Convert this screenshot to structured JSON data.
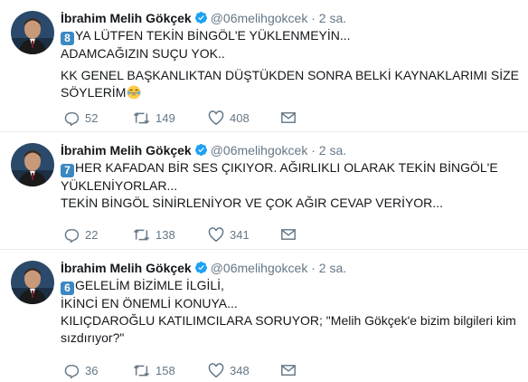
{
  "tweets": [
    {
      "author_name": "İbrahim Melih Gökçek",
      "handle": "@06melihgokcek",
      "dot": "·",
      "time": "2 sa.",
      "keycap": "8",
      "lines": [
        "YA LÜTFEN TEKİN BİNGÖL'E YÜKLENMEYİN...",
        "ADAMCAĞIZIN SUÇU YOK..",
        "",
        "KK GENEL BAŞKANLIKTAN DÜŞTÜKDEN SONRA BELKİ KAYNAKLARIMI SİZE",
        "SÖYLERİM"
      ],
      "emoji": "laughing-tears",
      "replies": "52",
      "retweets": "149",
      "likes": "408"
    },
    {
      "author_name": "İbrahim Melih Gökçek",
      "handle": "@06melihgokcek",
      "dot": "·",
      "time": "2 sa.",
      "keycap": "7",
      "lines": [
        "HER KAFADAN BİR SES ÇIKIYOR. AĞIRLIKLI OLARAK TEKİN BİNGÖL'E",
        "YÜKLENİYORLAR...",
        "TEKİN BİNGÖL SİNİRLENİYOR VE ÇOK AĞIR CEVAP VERİYOR..."
      ],
      "replies": "22",
      "retweets": "138",
      "likes": "341"
    },
    {
      "author_name": "İbrahim Melih Gökçek",
      "handle": "@06melihgokcek",
      "dot": "·",
      "time": "2 sa.",
      "keycap": "6",
      "lines": [
        "GELELİM BİZİMLE İLGİLİ,",
        "İKİNCİ EN ÖNEMLİ KONUYA...",
        "KILIÇDAROĞLU KATILIMCILARA SORUYOR; \"Melih Gökçek'e bizim bilgileri kim",
        "sızdırıyor?\""
      ],
      "replies": "36",
      "retweets": "158",
      "likes": "348"
    }
  ],
  "colors": {
    "text": "#14171a",
    "muted": "#657786",
    "verified": "#1da1f2",
    "divider": "#e6ecf0",
    "keycap": "#3b88c3"
  },
  "icons": {
    "reply": "reply-icon",
    "retweet": "retweet-icon",
    "like": "heart-icon",
    "dm": "envelope-icon",
    "verified": "verified-badge-icon"
  }
}
